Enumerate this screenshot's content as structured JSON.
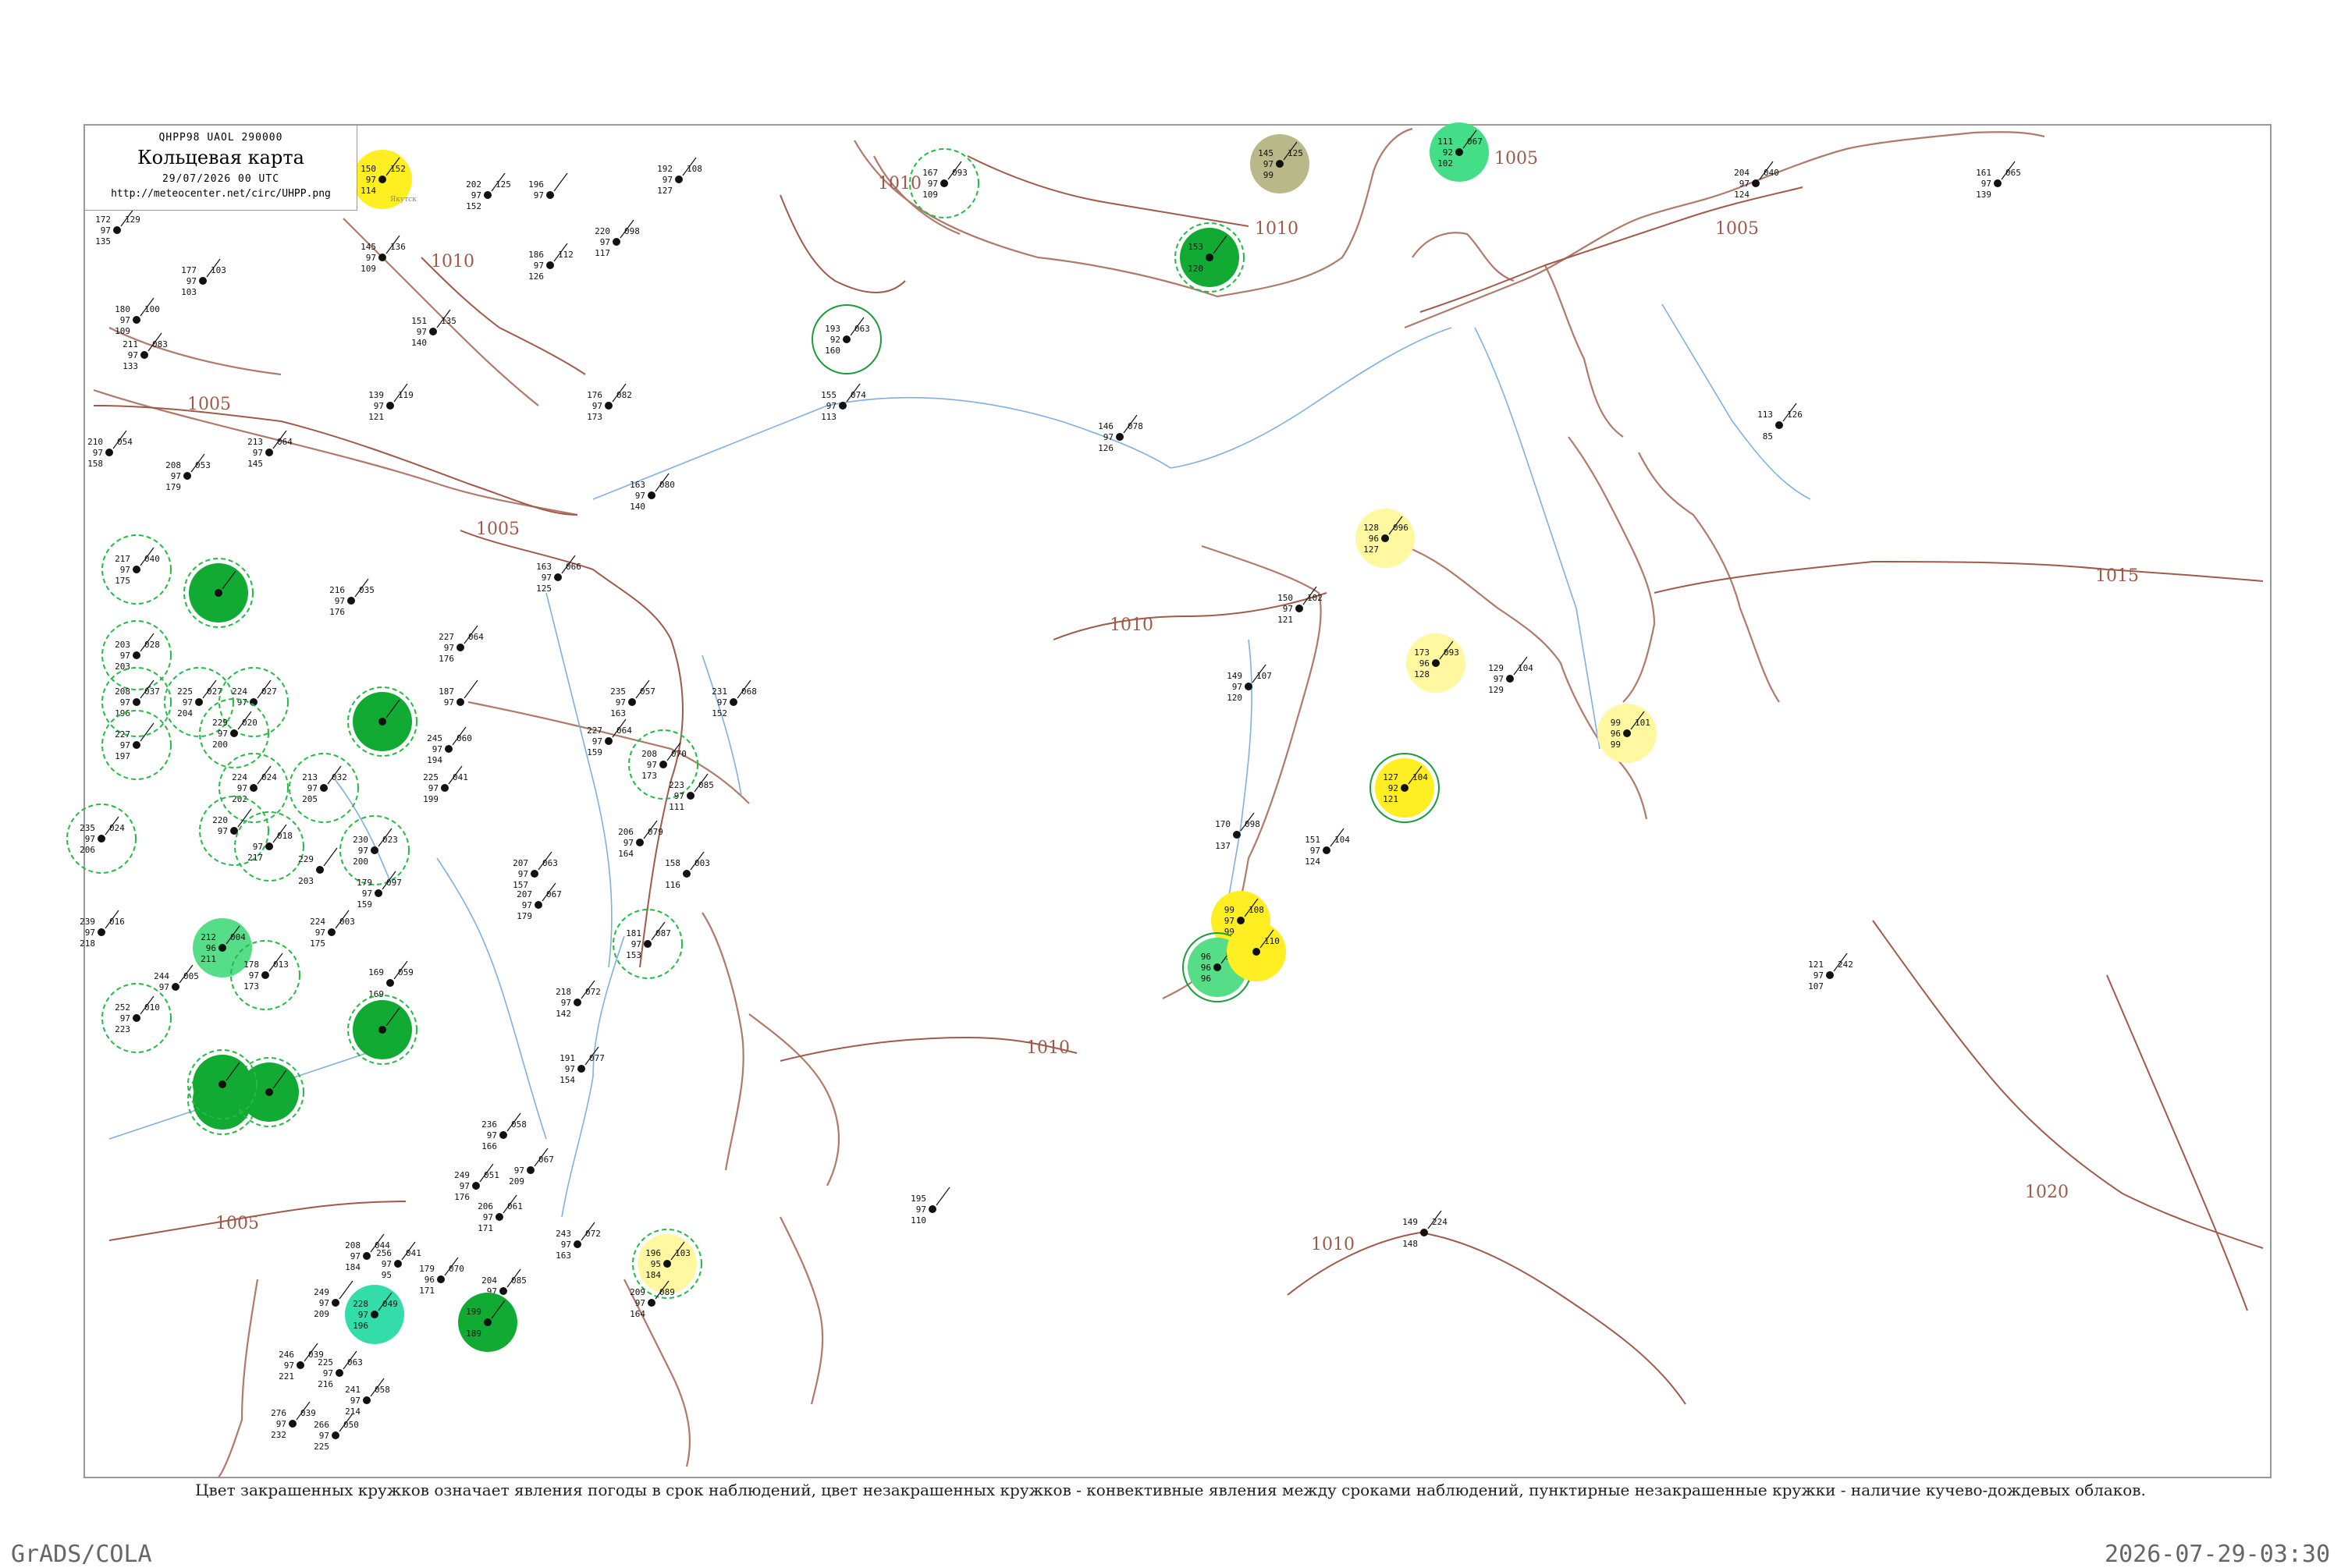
{
  "header": {
    "code": "QHPP98  UAOL  290000",
    "title": "Кольцевая карта",
    "datetime": "29/07/2026 00 UTC",
    "url": "http://meteocenter.net/circ/UHPP.png"
  },
  "caption": "Цвет закрашенных кружков означает явления погоды в срок наблюдений, цвет незакрашенных кружков - конвективные явления между сроками наблюдений, пунктирные незакрашенные кружки - наличие кучево-дождевых облаков.",
  "footer": {
    "left": "GrADS/COLA",
    "right": "2026-07-29-03:30"
  },
  "colors": {
    "isobar": "#a05a4a",
    "coast": "#b07a6a",
    "river": "#7fb0e0",
    "dashed_ring": "#22bb44"
  },
  "isobars": [
    {
      "label": "1005"
    },
    {
      "label": "1005"
    },
    {
      "label": "1005"
    },
    {
      "label": "1005"
    },
    {
      "label": "1005"
    },
    {
      "label": "1010"
    },
    {
      "label": "1010"
    },
    {
      "label": "1010"
    },
    {
      "label": "1010"
    },
    {
      "label": "1010"
    },
    {
      "label": "1010"
    },
    {
      "label": "1015"
    },
    {
      "label": "1020"
    }
  ],
  "stations": [
    {
      "name": "Якутск",
      "v1": "150",
      "v2": "97",
      "v3": "114",
      "v4": "152",
      "fill": "#ffee22",
      "ring": ""
    },
    {
      "name": "",
      "v1": "172",
      "v2": "97",
      "v3": "135",
      "v4": "129",
      "fill": "",
      "ring": ""
    },
    {
      "name": "",
      "v1": "202",
      "v2": "97",
      "v3": "152",
      "v4": "125",
      "fill": "",
      "ring": ""
    },
    {
      "name": "",
      "v1": "196",
      "v2": "97",
      "v3": "",
      "v4": "",
      "fill": "",
      "ring": ""
    },
    {
      "name": "",
      "v1": "192",
      "v2": "97",
      "v3": "127",
      "v4": "108",
      "fill": "",
      "ring": ""
    },
    {
      "name": "",
      "v1": "145",
      "v2": "97",
      "v3": "109",
      "v4": "136",
      "fill": "",
      "ring": ""
    },
    {
      "name": "",
      "v1": "186",
      "v2": "97",
      "v3": "126",
      "v4": "112",
      "fill": "",
      "ring": ""
    },
    {
      "name": "",
      "v1": "220",
      "v2": "97",
      "v3": "117",
      "v4": "098",
      "fill": "",
      "ring": ""
    },
    {
      "name": "",
      "v1": "177",
      "v2": "97",
      "v3": "103",
      "v4": "103",
      "fill": "",
      "ring": ""
    },
    {
      "name": "",
      "v1": "180",
      "v2": "97",
      "v3": "109",
      "v4": "100",
      "fill": "",
      "ring": ""
    },
    {
      "name": "",
      "v1": "211",
      "v2": "97",
      "v3": "133",
      "v4": "083",
      "fill": "",
      "ring": ""
    },
    {
      "name": "",
      "v1": "151",
      "v2": "97",
      "v3": "140",
      "v4": "135",
      "fill": "",
      "ring": ""
    },
    {
      "name": "",
      "v1": "139",
      "v2": "97",
      "v3": "121",
      "v4": "119",
      "fill": "",
      "ring": ""
    },
    {
      "name": "",
      "v1": "176",
      "v2": "97",
      "v3": "173",
      "v4": "082",
      "fill": "",
      "ring": ""
    },
    {
      "name": "",
      "v1": "155",
      "v2": "97",
      "v3": "113",
      "v4": "074",
      "fill": "",
      "ring": ""
    },
    {
      "name": "",
      "v1": "210",
      "v2": "97",
      "v3": "158",
      "v4": "054",
      "fill": "",
      "ring": ""
    },
    {
      "name": "",
      "v1": "208",
      "v2": "97",
      "v3": "179",
      "v4": "053",
      "fill": "",
      "ring": ""
    },
    {
      "name": "",
      "v1": "213",
      "v2": "97",
      "v3": "145",
      "v4": "064",
      "fill": "",
      "ring": ""
    },
    {
      "name": "",
      "v1": "163",
      "v2": "97",
      "v3": "140",
      "v4": "080",
      "fill": "",
      "ring": ""
    },
    {
      "name": "",
      "v1": "146",
      "v2": "97",
      "v3": "126",
      "v4": "078",
      "fill": "",
      "ring": ""
    },
    {
      "name": "",
      "v1": "217",
      "v2": "97",
      "v3": "175",
      "v4": "040",
      "fill": "",
      "ring": "dashed"
    },
    {
      "name": "",
      "v1": "",
      "v2": "",
      "v3": "",
      "v4": "",
      "fill": "#11aa33",
      "ring": "dashed"
    },
    {
      "name": "",
      "v1": "163",
      "v2": "97",
      "v3": "125",
      "v4": "066",
      "fill": "",
      "ring": ""
    },
    {
      "name": "",
      "v1": "216",
      "v2": "97",
      "v3": "176",
      "v4": "035",
      "fill": "",
      "ring": ""
    },
    {
      "name": "",
      "v1": "128",
      "v2": "96",
      "v3": "127",
      "v4": "096",
      "fill": "#fff8a0",
      "ring": ""
    },
    {
      "name": "",
      "v1": "150",
      "v2": "97",
      "v3": "121",
      "v4": "102",
      "fill": "",
      "ring": ""
    },
    {
      "name": "",
      "v1": "173",
      "v2": "96",
      "v3": "128",
      "v4": "093",
      "fill": "#fff8a0",
      "ring": ""
    },
    {
      "name": "",
      "v1": "149",
      "v2": "97",
      "v3": "120",
      "v4": "107",
      "fill": "",
      "ring": ""
    },
    {
      "name": "",
      "v1": "129",
      "v2": "97",
      "v3": "129",
      "v4": "104",
      "fill": "",
      "ring": ""
    },
    {
      "name": "",
      "v1": "99",
      "v2": "96",
      "v3": "99",
      "v4": "101",
      "fill": "#fff8a0",
      "ring": ""
    },
    {
      "name": "",
      "v1": "127",
      "v2": "92",
      "v3": "121",
      "v4": "104",
      "fill": "#ffee22",
      "ring": "solid"
    },
    {
      "name": "",
      "v1": "145",
      "v2": "97",
      "v3": "99",
      "v4": "125",
      "fill": "#b8b888",
      "ring": ""
    },
    {
      "name": "",
      "v1": "111",
      "v2": "92",
      "v3": "102",
      "v4": "067",
      "fill": "#44dd88",
      "ring": ""
    },
    {
      "name": "",
      "v1": "153",
      "v2": "",
      "v3": "120",
      "v4": "",
      "fill": "#11aa33",
      "ring": "dashed"
    },
    {
      "name": "",
      "v1": "167",
      "v2": "97",
      "v3": "109",
      "v4": "093",
      "fill": "",
      "ring": "dashed"
    },
    {
      "name": "",
      "v1": "193",
      "v2": "92",
      "v3": "160",
      "v4": "063",
      "fill": "",
      "ring": "solid"
    },
    {
      "name": "",
      "v1": "204",
      "v2": "97",
      "v3": "124",
      "v4": "040",
      "fill": "",
      "ring": ""
    },
    {
      "name": "",
      "v1": "161",
      "v2": "97",
      "v3": "139",
      "v4": "065",
      "fill": "",
      "ring": ""
    },
    {
      "name": "",
      "v1": "113",
      "v2": "",
      "v3": "85",
      "v4": "126",
      "fill": "",
      "ring": ""
    },
    {
      "name": "",
      "v1": "203",
      "v2": "97",
      "v3": "203",
      "v4": "028",
      "fill": "",
      "ring": "dashed"
    },
    {
      "name": "",
      "v1": "208",
      "v2": "97",
      "v3": "196",
      "v4": "037",
      "fill": "",
      "ring": "dashed"
    },
    {
      "name": "",
      "v1": "227",
      "v2": "97",
      "v3": "197",
      "v4": "",
      "fill": "",
      "ring": "dashed"
    },
    {
      "name": "",
      "v1": "225",
      "v2": "97",
      "v3": "204",
      "v4": "027",
      "fill": "",
      "ring": "dashed"
    },
    {
      "name": "",
      "v1": "224",
      "v2": "97",
      "v3": "",
      "v4": "027",
      "fill": "",
      "ring": "dashed"
    },
    {
      "name": "",
      "v1": "229",
      "v2": "97",
      "v3": "200",
      "v4": "020",
      "fill": "",
      "ring": "dashed"
    },
    {
      "name": "",
      "v1": "",
      "v2": "",
      "v3": "",
      "v4": "",
      "fill": "#11aa33",
      "ring": "dashed"
    },
    {
      "name": "",
      "v1": "227",
      "v2": "97",
      "v3": "176",
      "v4": "064",
      "fill": "",
      "ring": ""
    },
    {
      "name": "",
      "v1": "187",
      "v2": "97",
      "v3": "",
      "v4": "",
      "fill": "",
      "ring": ""
    },
    {
      "name": "",
      "v1": "245",
      "v2": "97",
      "v3": "194",
      "v4": "060",
      "fill": "",
      "ring": ""
    },
    {
      "name": "",
      "v1": "225",
      "v2": "97",
      "v3": "199",
      "v4": "041",
      "fill": "",
      "ring": ""
    },
    {
      "name": "",
      "v1": "213",
      "v2": "97",
      "v3": "205",
      "v4": "032",
      "fill": "",
      "ring": "dashed"
    },
    {
      "name": "",
      "v1": "224",
      "v2": "97",
      "v3": "202",
      "v4": "024",
      "fill": "",
      "ring": "dashed"
    },
    {
      "name": "",
      "v1": "220",
      "v2": "97",
      "v3": "",
      "v4": "",
      "fill": "",
      "ring": "dashed"
    },
    {
      "name": "",
      "v1": "",
      "v2": "97",
      "v3": "217",
      "v4": "018",
      "fill": "",
      "ring": "dashed"
    },
    {
      "name": "",
      "v1": "230",
      "v2": "97",
      "v3": "200",
      "v4": "023",
      "fill": "",
      "ring": "dashed"
    },
    {
      "name": "",
      "v1": "235",
      "v2": "97",
      "v3": "206",
      "v4": "024",
      "fill": "",
      "ring": "dashed"
    },
    {
      "name": "",
      "v1": "229",
      "v2": "",
      "v3": "203",
      "v4": "",
      "fill": "",
      "ring": ""
    },
    {
      "name": "",
      "v1": "179",
      "v2": "97",
      "v3": "159",
      "v4": "097",
      "fill": "",
      "ring": ""
    },
    {
      "name": "",
      "v1": "239",
      "v2": "97",
      "v3": "218",
      "v4": "016",
      "fill": "",
      "ring": ""
    },
    {
      "name": "",
      "v1": "224",
      "v2": "97",
      "v3": "175",
      "v4": "003",
      "fill": "",
      "ring": ""
    },
    {
      "name": "",
      "v1": "212",
      "v2": "96",
      "v3": "211",
      "v4": "004",
      "fill": "#55dd88",
      "ring": ""
    },
    {
      "name": "",
      "v1": "244",
      "v2": "97",
      "v3": "",
      "v4": "005",
      "fill": "",
      "ring": ""
    },
    {
      "name": "",
      "v1": "178",
      "v2": "97",
      "v3": "173",
      "v4": "013",
      "fill": "",
      "ring": "dashed"
    },
    {
      "name": "",
      "v1": "252",
      "v2": "97",
      "v3": "223",
      "v4": "010",
      "fill": "",
      "ring": "dashed"
    },
    {
      "name": "",
      "v1": "169",
      "v2": "",
      "v3": "169",
      "v4": "059",
      "fill": "",
      "ring": ""
    },
    {
      "name": "",
      "v1": "",
      "v2": "",
      "v3": "",
      "v4": "",
      "fill": "#11aa33",
      "ring": "dashed"
    },
    {
      "name": "",
      "v1": "",
      "v2": "",
      "v3": "",
      "v4": "",
      "fill": "#11aa33",
      "ring": "dashed"
    },
    {
      "name": "",
      "v1": "",
      "v2": "",
      "v3": "",
      "v4": "",
      "fill": "#11aa33",
      "ring": "dashed"
    },
    {
      "name": "",
      "v1": "",
      "v2": "",
      "v3": "",
      "v4": "",
      "fill": "#11aa33",
      "ring": "dashed"
    },
    {
      "name": "",
      "v1": "235",
      "v2": "97",
      "v3": "163",
      "v4": "057",
      "fill": "",
      "ring": ""
    },
    {
      "name": "",
      "v1": "231",
      "v2": "97",
      "v3": "152",
      "v4": "068",
      "fill": "",
      "ring": ""
    },
    {
      "name": "",
      "v1": "227",
      "v2": "97",
      "v3": "159",
      "v4": "064",
      "fill": "",
      "ring": ""
    },
    {
      "name": "",
      "v1": "208",
      "v2": "97",
      "v3": "173",
      "v4": "070",
      "fill": "",
      "ring": "dashed"
    },
    {
      "name": "",
      "v1": "223",
      "v2": "97",
      "v3": "111",
      "v4": "085",
      "fill": "",
      "ring": ""
    },
    {
      "name": "",
      "v1": "206",
      "v2": "97",
      "v3": "164",
      "v4": "079",
      "fill": "",
      "ring": ""
    },
    {
      "name": "",
      "v1": "158",
      "v2": "",
      "v3": "116",
      "v4": "003",
      "fill": "",
      "ring": ""
    },
    {
      "name": "",
      "v1": "207",
      "v2": "97",
      "v3": "157",
      "v4": "063",
      "fill": "",
      "ring": ""
    },
    {
      "name": "",
      "v1": "207",
      "v2": "97",
      "v3": "179",
      "v4": "067",
      "fill": "",
      "ring": ""
    },
    {
      "name": "",
      "v1": "181",
      "v2": "97",
      "v3": "153",
      "v4": "087",
      "fill": "",
      "ring": "dashed"
    },
    {
      "name": "",
      "v1": "218",
      "v2": "97",
      "v3": "142",
      "v4": "072",
      "fill": "",
      "ring": ""
    },
    {
      "name": "",
      "v1": "191",
      "v2": "97",
      "v3": "154",
      "v4": "077",
      "fill": "",
      "ring": ""
    },
    {
      "name": "",
      "v1": "170",
      "v2": "",
      "v3": "137",
      "v4": "098",
      "fill": "",
      "ring": ""
    },
    {
      "name": "",
      "v1": "151",
      "v2": "97",
      "v3": "124",
      "v4": "104",
      "fill": "",
      "ring": ""
    },
    {
      "name": "",
      "v1": "99",
      "v2": "97",
      "v3": "99",
      "v4": "108",
      "fill": "#ffee22",
      "ring": ""
    },
    {
      "name": "",
      "v1": "96",
      "v2": "96",
      "v3": "96",
      "v4": "111",
      "fill": "#55dd88",
      "ring": "solid"
    },
    {
      "name": "",
      "v1": "",
      "v2": "",
      "v3": "",
      "v4": "110",
      "fill": "#ffee22",
      "ring": ""
    },
    {
      "name": "",
      "v1": "121",
      "v2": "97",
      "v3": "107",
      "v4": "242",
      "fill": "",
      "ring": ""
    },
    {
      "name": "",
      "v1": "236",
      "v2": "97",
      "v3": "166",
      "v4": "058",
      "fill": "",
      "ring": ""
    },
    {
      "name": "",
      "v1": "",
      "v2": "97",
      "v3": "209",
      "v4": "067",
      "fill": "",
      "ring": ""
    },
    {
      "name": "",
      "v1": "249",
      "v2": "97",
      "v3": "176",
      "v4": "051",
      "fill": "",
      "ring": ""
    },
    {
      "name": "",
      "v1": "206",
      "v2": "97",
      "v3": "171",
      "v4": "061",
      "fill": "",
      "ring": ""
    },
    {
      "name": "",
      "v1": "243",
      "v2": "97",
      "v3": "163",
      "v4": "072",
      "fill": "",
      "ring": ""
    },
    {
      "name": "",
      "v1": "196",
      "v2": "95",
      "v3": "184",
      "v4": "103",
      "fill": "#fff8a0",
      "ring": "dashed"
    },
    {
      "name": "",
      "v1": "195",
      "v2": "97",
      "v3": "110",
      "v4": "",
      "fill": "",
      "ring": ""
    },
    {
      "name": "",
      "v1": "149",
      "v2": "",
      "v3": "148",
      "v4": "224",
      "fill": "",
      "ring": ""
    },
    {
      "name": "",
      "v1": "208",
      "v2": "97",
      "v3": "184",
      "v4": "044",
      "fill": "",
      "ring": ""
    },
    {
      "name": "",
      "v1": "256",
      "v2": "97",
      "v3": "95",
      "v4": "041",
      "fill": "",
      "ring": ""
    },
    {
      "name": "",
      "v1": "179",
      "v2": "96",
      "v3": "171",
      "v4": "070",
      "fill": "",
      "ring": ""
    },
    {
      "name": "",
      "v1": "204",
      "v2": "97",
      "v3": "176",
      "v4": "085",
      "fill": "",
      "ring": ""
    },
    {
      "name": "",
      "v1": "209",
      "v2": "97",
      "v3": "164",
      "v4": "089",
      "fill": "",
      "ring": ""
    },
    {
      "name": "",
      "v1": "249",
      "v2": "97",
      "v3": "209",
      "v4": "",
      "fill": "",
      "ring": ""
    },
    {
      "name": "",
      "v1": "228",
      "v2": "97",
      "v3": "196",
      "v4": "049",
      "fill": "#33ddaa",
      "ring": ""
    },
    {
      "name": "",
      "v1": "199",
      "v2": "",
      "v3": "189",
      "v4": "",
      "fill": "#11aa33",
      "ring": ""
    },
    {
      "name": "",
      "v1": "246",
      "v2": "97",
      "v3": "221",
      "v4": "039",
      "fill": "",
      "ring": ""
    },
    {
      "name": "",
      "v1": "225",
      "v2": "97",
      "v3": "216",
      "v4": "063",
      "fill": "",
      "ring": ""
    },
    {
      "name": "",
      "v1": "241",
      "v2": "97",
      "v3": "214",
      "v4": "058",
      "fill": "",
      "ring": ""
    },
    {
      "name": "",
      "v1": "276",
      "v2": "97",
      "v3": "232",
      "v4": "039",
      "fill": "",
      "ring": ""
    },
    {
      "name": "",
      "v1": "266",
      "v2": "97",
      "v3": "225",
      "v4": "050",
      "fill": "",
      "ring": ""
    }
  ]
}
